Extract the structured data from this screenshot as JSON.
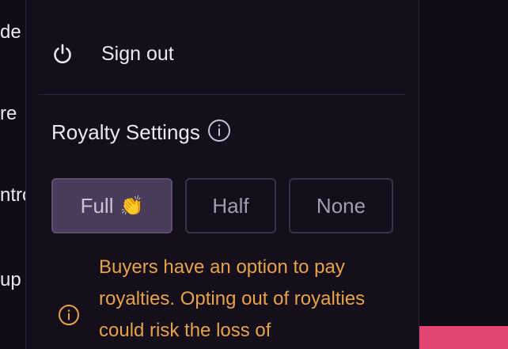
{
  "background_menu": {
    "items": [
      "de",
      "re",
      "ntro",
      "up"
    ]
  },
  "account_menu": {
    "sign_out_label": "Sign out",
    "royalty_settings": {
      "title": "Royalty Settings",
      "options": [
        {
          "label": "Full",
          "emoji": "👏",
          "selected": true
        },
        {
          "label": "Half",
          "selected": false
        },
        {
          "label": "None",
          "selected": false
        }
      ],
      "notice": "Buyers have an option to pay royalties. Opting out of royalties could risk the loss of"
    }
  },
  "colors": {
    "accent_warning": "#e6a34a",
    "selected_option_bg": "#4a3b5a",
    "pink_accent": "#e0446f"
  },
  "icons": {
    "sign_out": "power-icon",
    "info": "info-circle-icon",
    "warning": "info-circle-icon"
  }
}
